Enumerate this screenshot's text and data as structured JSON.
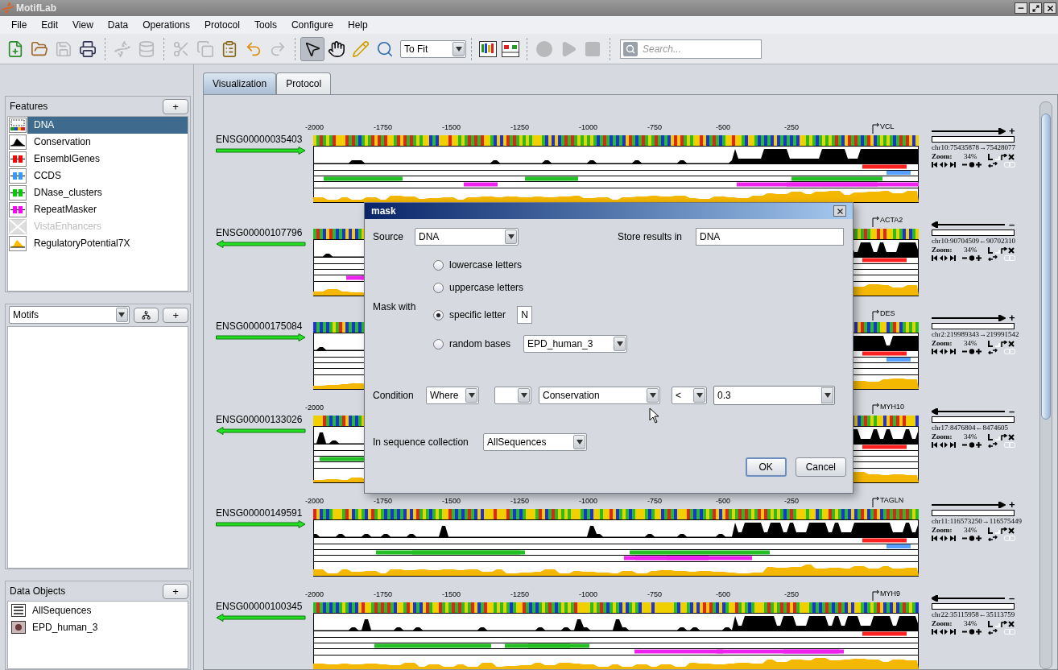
{
  "window": {
    "title": "MotifLab"
  },
  "menu": [
    "File",
    "Edit",
    "View",
    "Data",
    "Operations",
    "Protocol",
    "Tools",
    "Configure",
    "Help"
  ],
  "toolbar": {
    "groups": [
      [
        {
          "kind": "new",
          "disabled": false
        },
        {
          "kind": "open",
          "disabled": false
        },
        {
          "kind": "save",
          "disabled": true
        },
        {
          "kind": "print",
          "disabled": false
        }
      ],
      [
        {
          "kind": "sequences",
          "disabled": true
        },
        {
          "kind": "database",
          "disabled": true
        }
      ],
      [
        {
          "kind": "cut",
          "disabled": true
        },
        {
          "kind": "copy",
          "disabled": true
        },
        {
          "kind": "paste",
          "disabled": false
        },
        {
          "kind": "undo",
          "disabled": false
        },
        {
          "kind": "redo",
          "disabled": true
        }
      ],
      [
        {
          "kind": "select",
          "selected": true
        },
        {
          "kind": "pan",
          "selected": false
        },
        {
          "kind": "draw",
          "selected": false
        },
        {
          "kind": "zoom",
          "selected": false
        }
      ],
      [
        {
          "kind": "motif-logo"
        },
        {
          "kind": "tracks"
        }
      ],
      [
        {
          "kind": "record",
          "disabled": true
        },
        {
          "kind": "play",
          "disabled": true
        },
        {
          "kind": "stop",
          "disabled": true
        }
      ]
    ],
    "zoom_dropdown": "To Fit",
    "search": {
      "placeholder": "Search..."
    }
  },
  "features": {
    "title": "Features",
    "add": "+",
    "items": [
      {
        "name": "DNA",
        "kind": "dna",
        "selected": true,
        "disabled": false
      },
      {
        "name": "Conservation",
        "kind": "graph",
        "selected": false,
        "disabled": false,
        "color": "#000000"
      },
      {
        "name": "EnsemblGenes",
        "kind": "region",
        "selected": false,
        "disabled": false,
        "color": "#ff0000"
      },
      {
        "name": "CCDS",
        "kind": "region",
        "selected": false,
        "disabled": false,
        "color": "#3399ff"
      },
      {
        "name": "DNase_clusters",
        "kind": "region",
        "selected": false,
        "disabled": false,
        "color": "#00cc00"
      },
      {
        "name": "RepeatMasker",
        "kind": "region",
        "selected": false,
        "disabled": false,
        "color": "#ff00ff"
      },
      {
        "name": "VistaEnhancers",
        "kind": "region",
        "selected": false,
        "disabled": true,
        "color": "#cccccc"
      },
      {
        "name": "RegulatoryPotential7X",
        "kind": "graph",
        "selected": false,
        "disabled": false,
        "color": "#ffbb00"
      }
    ]
  },
  "motifs": {
    "dropdown": "Motifs",
    "add": "+"
  },
  "data_objects": {
    "title": "Data Objects",
    "add": "+",
    "items": [
      {
        "name": "AllSequences",
        "kind": "collection"
      },
      {
        "name": "EPD_human_3",
        "kind": "motif-set"
      }
    ]
  },
  "tabs": [
    {
      "label": "Visualization",
      "selected": true
    },
    {
      "label": "Protocol",
      "selected": false
    }
  ],
  "sequences": [
    {
      "name": "ENSG00000035403",
      "kind": "forward",
      "gene": "VCL",
      "strand": "+",
      "coords": "chr10:75435878→75428077",
      "zoom_label": "Zoom:",
      "zoom": "34%",
      "ticks": [
        "-2000",
        "-1750",
        "-1500",
        "-1250",
        "-1000",
        "-750",
        "-500",
        "-250"
      ]
    },
    {
      "name": "ENSG00000107796",
      "kind": "reverse",
      "gene": "ACTA2",
      "strand": "–",
      "coords": "chr10:90704509←90702310",
      "zoom_label": "Zoom:",
      "zoom": "34%"
    },
    {
      "name": "ENSG00000175084",
      "kind": "forward",
      "gene": "DES",
      "strand": "+",
      "coords": "chr2:219989343→219991542",
      "zoom_label": "Zoom:",
      "zoom": "34%"
    },
    {
      "name": "ENSG00000133026",
      "kind": "reverse",
      "gene": "MYH10",
      "strand": "–",
      "coords": "chr17:8476804←8474605",
      "zoom_label": "Zoom:",
      "zoom": "34%",
      "ticks": [
        "-2000"
      ]
    },
    {
      "name": "ENSG00000149591",
      "kind": "forward",
      "gene": "TAGLN",
      "strand": "+",
      "coords": "chr11:116573250→116575449",
      "zoom_label": "Zoom:",
      "zoom": "34%",
      "ticks": [
        "-2000",
        "-1750",
        "-1500",
        "-1250",
        "-1000",
        "-750",
        "-500",
        "-250"
      ]
    },
    {
      "name": "ENSG00000100345",
      "kind": "reverse",
      "gene": "MYH9",
      "strand": "–",
      "coords": "chr22:35115958←35113759",
      "zoom_label": "Zoom:",
      "zoom": "34%",
      "ticks": [
        "-2000",
        "-1750",
        "-1500",
        "-1250",
        "-1000",
        "-750",
        "-500",
        "-250"
      ]
    }
  ],
  "dialog": {
    "title": "mask",
    "source_label": "Source",
    "source": "DNA",
    "store_label": "Store results in",
    "store": "DNA",
    "mask_label": "Mask with",
    "options": [
      {
        "label": "lowercase letters",
        "selected": false,
        "kind": "plain"
      },
      {
        "label": "uppercase letters",
        "selected": false,
        "kind": "plain"
      },
      {
        "label": "specific letter",
        "selected": true,
        "kind": "letter",
        "value": "N"
      },
      {
        "label": "random bases",
        "selected": false,
        "kind": "dropdown",
        "value": "EPD_human_3"
      }
    ],
    "condition_label": "Condition",
    "condition": [
      {
        "kind": "dropdown",
        "value": "Where"
      },
      {
        "kind": "dropdown"
      },
      {
        "kind": "dropdown",
        "value": "Conservation"
      },
      {
        "kind": "dropdown",
        "value": "<"
      },
      {
        "kind": "combo",
        "value": "0.3"
      }
    ],
    "collection_label": "In sequence collection",
    "collection": "AllSequences",
    "buttons": [
      {
        "label": "OK",
        "selected": true
      },
      {
        "label": "Cancel",
        "selected": false
      }
    ]
  }
}
